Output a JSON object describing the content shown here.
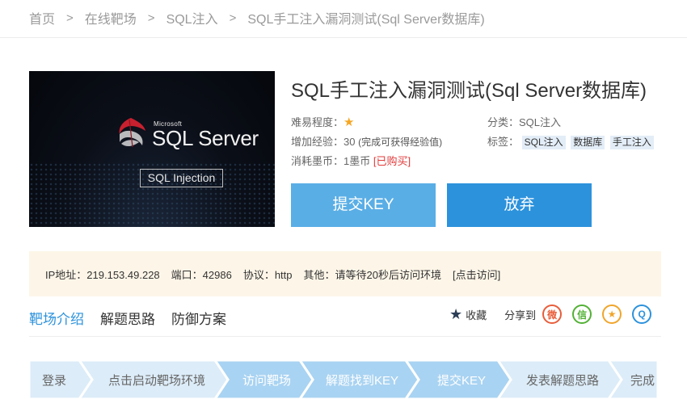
{
  "breadcrumb": {
    "items": [
      "首页",
      "在线靶场",
      "SQL注入",
      "SQL手工注入漏洞测试(Sql Server数据库)"
    ],
    "separator": ">"
  },
  "cover": {
    "brand_small": "Microsoft",
    "brand_large": "SQL Server",
    "caption": "SQL Injection"
  },
  "lab": {
    "title": "SQL手工注入漏洞测试(Sql Server数据库)",
    "difficulty_label": "难易程度：",
    "difficulty_stars": 1,
    "exp_label": "增加经验：30",
    "exp_note": "(完成可获得经验值)",
    "cost_label": "消耗墨币：1墨币",
    "purchased": "[已购买]",
    "category_label": "分类：SQL注入",
    "tags_label": "标签：",
    "tags": [
      "SQL注入",
      "数据库",
      "手工注入"
    ]
  },
  "buttons": {
    "submit": "提交KEY",
    "give_up": "放弃"
  },
  "env": {
    "ip": "IP地址：219.153.49.228",
    "port": "端口：42986",
    "protocol": "协议：http",
    "other": "其他：请等待20秒后访问环境",
    "visit": "[点击访问]"
  },
  "tabs": [
    "靶场介绍",
    "解题思路",
    "防御方案"
  ],
  "share": {
    "favorite": "收藏",
    "share_to": "分享到"
  },
  "steps": [
    "登录",
    "点击启动靶场环境",
    "访问靶场",
    "解题找到KEY",
    "提交KEY",
    "发表解题思路",
    "完成"
  ],
  "colors": {
    "accent": "#2c92dc",
    "submit_button": "#5aaee6",
    "env_bg": "#fdf6e8",
    "step_light": "#dcecf8",
    "step_dark": "#a9d3f2"
  }
}
